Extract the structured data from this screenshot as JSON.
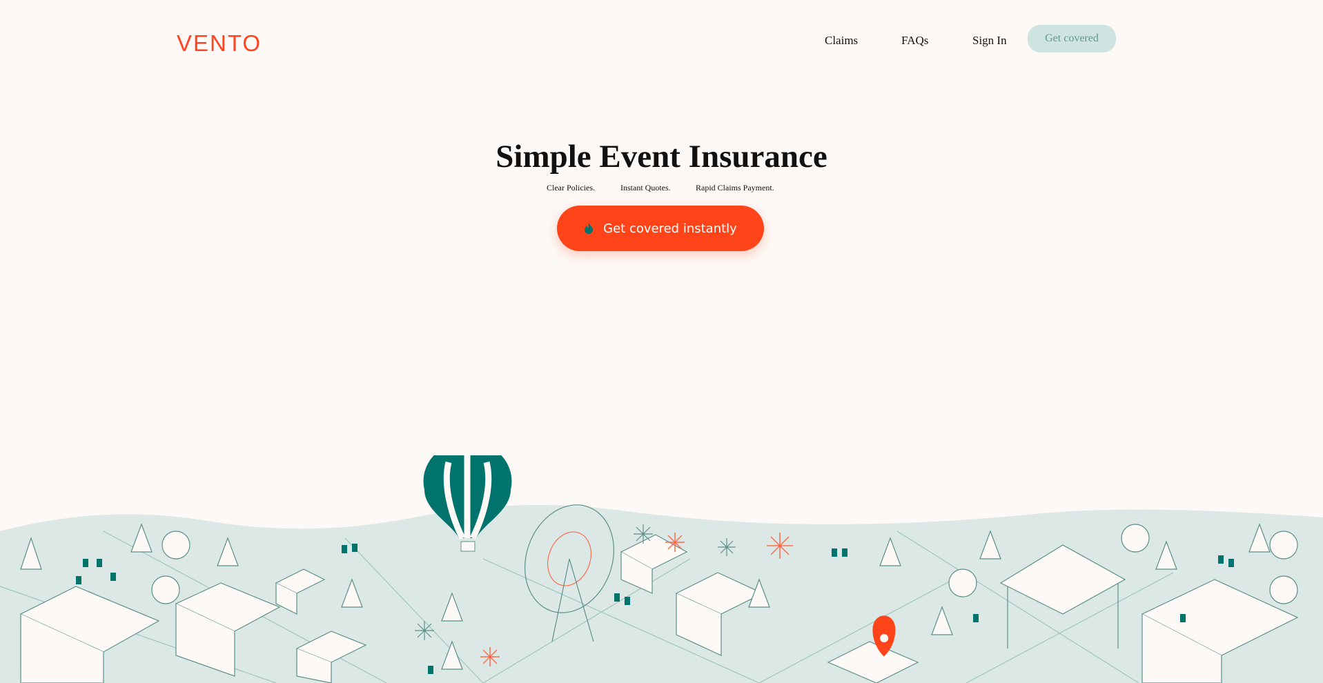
{
  "nav": {
    "logo": "VENTO",
    "links": [
      "Claims",
      "FAQs",
      "Sign In"
    ],
    "cta": "Get covered"
  },
  "hero": {
    "title": "Simple Event Insurance",
    "taglines": [
      "Clear Policies.",
      "Instant Quotes.",
      "Rapid Claims Payment."
    ],
    "cta": "Get covered instantly"
  },
  "colors": {
    "brand": "#ff4419",
    "teal": "#00736d",
    "mint": "#dbe8e6",
    "background": "#fdf9f6"
  },
  "icons": {
    "cta_icon": "flame-icon",
    "map_marker": "location-pin-icon"
  }
}
